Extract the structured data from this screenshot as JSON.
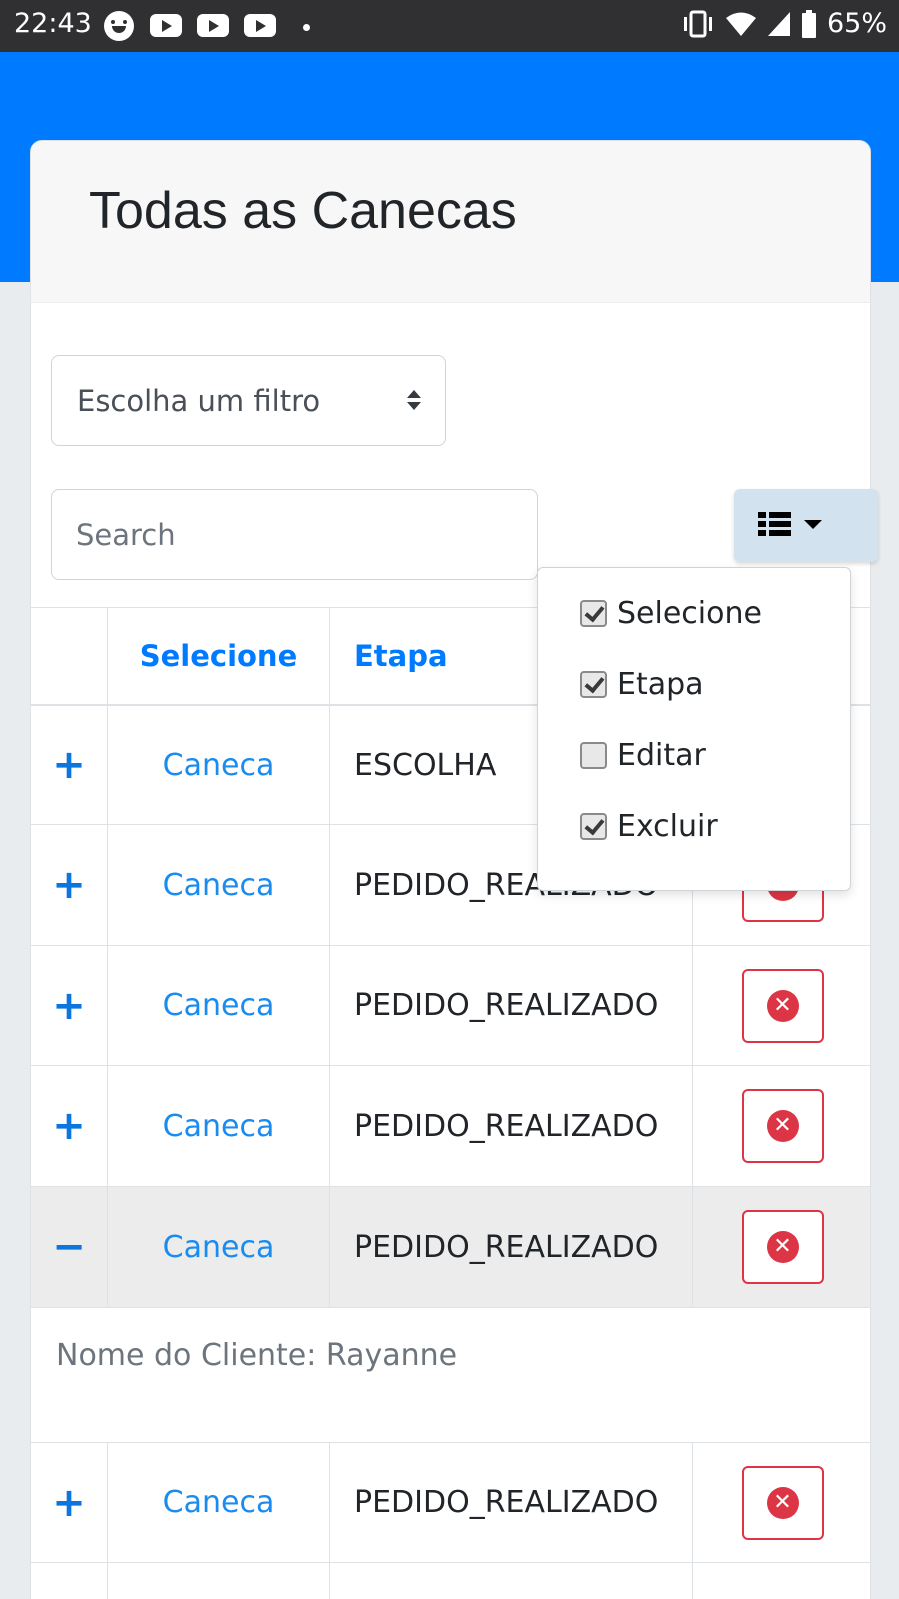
{
  "status_bar": {
    "time": "22:43",
    "battery": "65%"
  },
  "header": {
    "title": "Todas as Canecas"
  },
  "filter": {
    "label": "Escolha um filtro"
  },
  "search": {
    "placeholder": "Search"
  },
  "table": {
    "headers": {
      "select": "Selecione",
      "stage": "Etapa"
    },
    "rows": [
      {
        "toggle": "+",
        "name": "Caneca",
        "stage": "ESCOLHA"
      },
      {
        "toggle": "+",
        "name": "Caneca",
        "stage": "PEDIDO_REALIZADO"
      },
      {
        "toggle": "+",
        "name": "Caneca",
        "stage": "PEDIDO_REALIZADO"
      },
      {
        "toggle": "+",
        "name": "Caneca",
        "stage": "PEDIDO_REALIZADO"
      },
      {
        "toggle": "−",
        "name": "Caneca",
        "stage": "PEDIDO_REALIZADO"
      },
      {
        "toggle": "+",
        "name": "Caneca",
        "stage": "PEDIDO_REALIZADO"
      }
    ],
    "detail": {
      "text": "Nome do Cliente: Rayanne"
    }
  },
  "column_menu": {
    "items": [
      {
        "label": "Selecione",
        "checked": true
      },
      {
        "label": "Etapa",
        "checked": true
      },
      {
        "label": "Editar",
        "checked": false
      },
      {
        "label": "Excluir",
        "checked": true
      }
    ]
  },
  "colors": {
    "primary": "#007bff",
    "danger": "#dc3545",
    "status_bar": "#303033"
  }
}
